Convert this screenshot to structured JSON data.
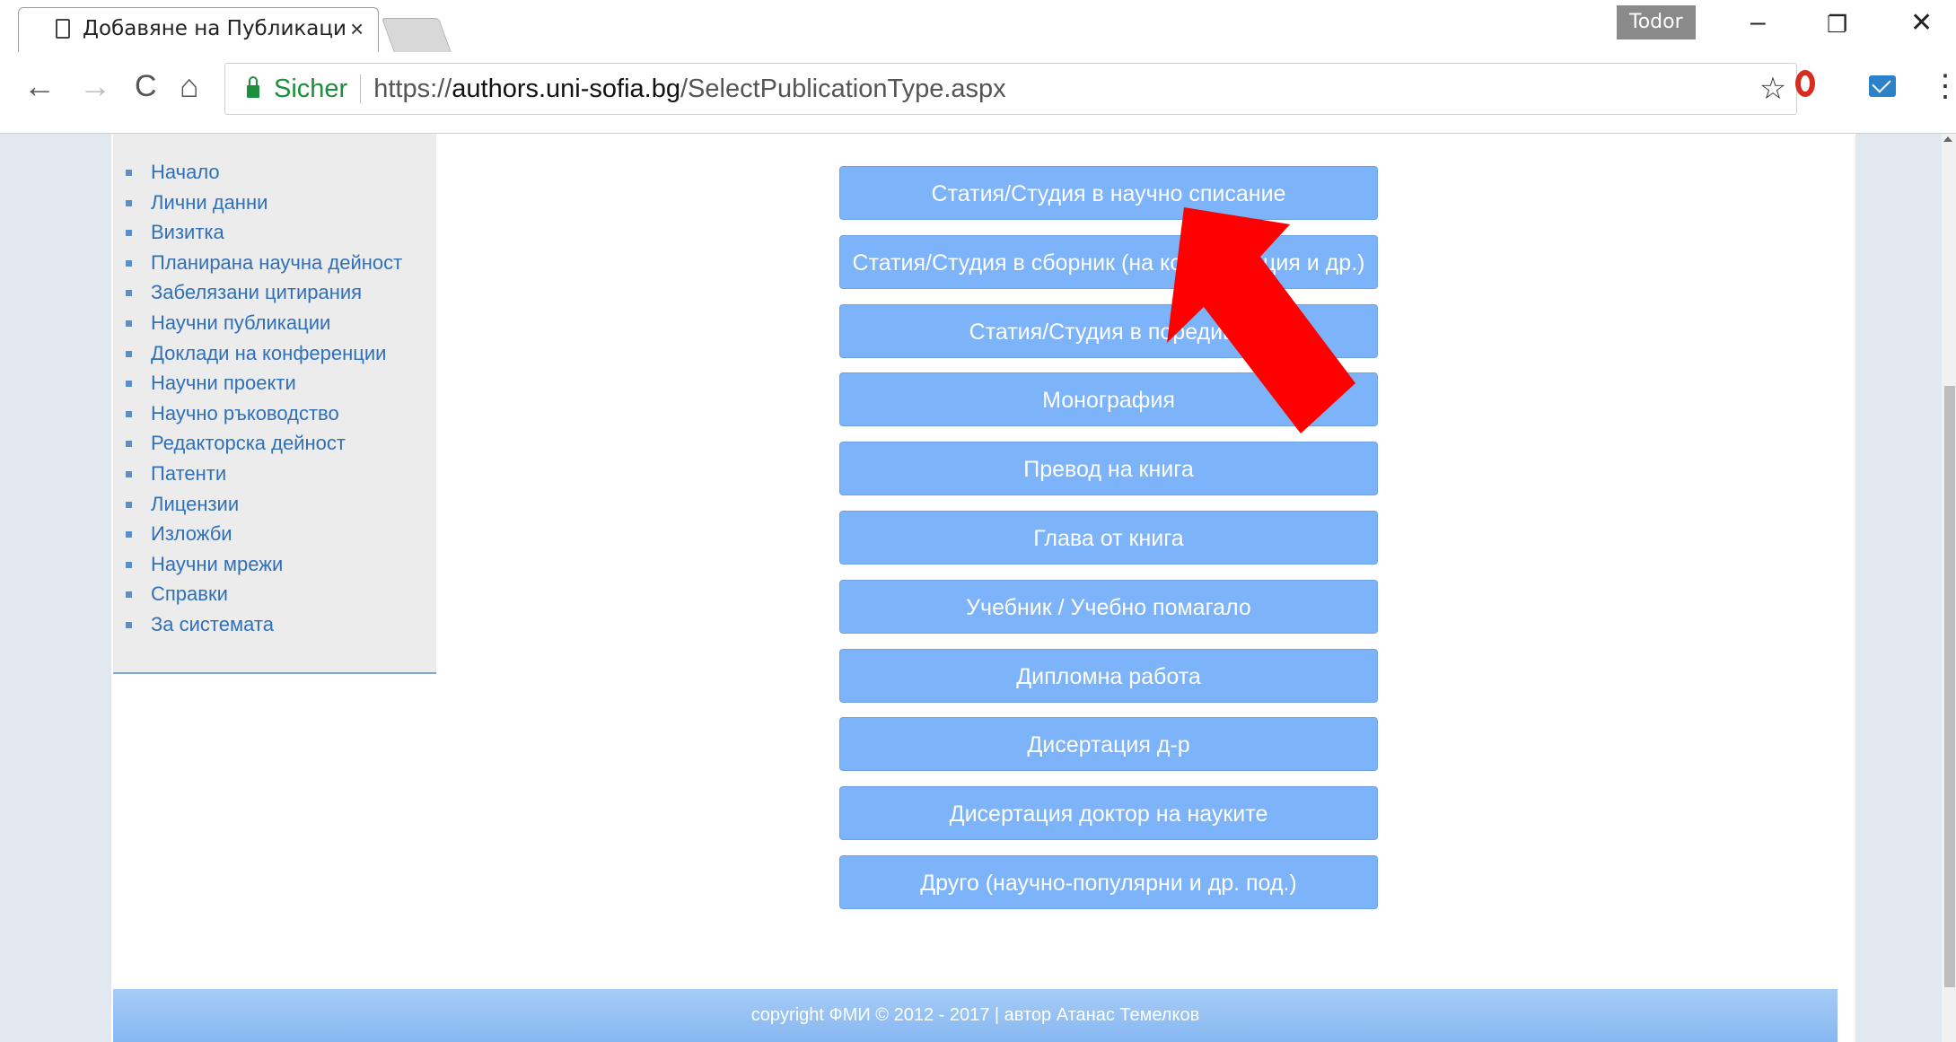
{
  "browser": {
    "tab_title": "Добавяне на Публикаци",
    "tab_close": "×",
    "profile_name": "Todor",
    "window_controls": {
      "minimize": "–",
      "restore": "❐",
      "close": "✕"
    },
    "nav": {
      "back": "←",
      "forward": "→",
      "reload": "C",
      "home": "⌂"
    },
    "secure_label": "Sicher",
    "url_scheme": "https://",
    "url_host": "authors.uni-sofia.bg",
    "url_path": "/SelectPublicationType.aspx",
    "bookmark_star": "☆",
    "menu_dots": "⋮"
  },
  "sidebar": {
    "items": [
      "Начало",
      "Лични данни",
      "Визитка",
      "Планирана научна дейност",
      "Забелязани цитирания",
      "Научни публикации",
      "Доклади на конференции",
      "Научни проекти",
      "Научно ръководство",
      "Редакторска дейност",
      "Патенти",
      "Лицензии",
      "Изложби",
      "Научни мрежи",
      "Справки",
      "За системата"
    ]
  },
  "publication_types": [
    "Статия/Студия в научно списание",
    "Статия/Студия в сборник (на конференция и др.)",
    "Статия/Студия в поредица",
    "Монография",
    "Превод на книга",
    "Глава от книга",
    "Учебник / Учебно помагало",
    "Дипломна работа",
    "Дисертация д-р",
    "Дисертация доктор на науките",
    "Друго (научно-популярни и др. под.)"
  ],
  "footer": {
    "text": "copyright ФМИ © 2012 - 2017 | автор Атанас Темелков"
  },
  "colors": {
    "button_bg": "#7db3f8",
    "link": "#3070b6",
    "arrow": "#ff0000",
    "secure": "#1a8f3c"
  }
}
